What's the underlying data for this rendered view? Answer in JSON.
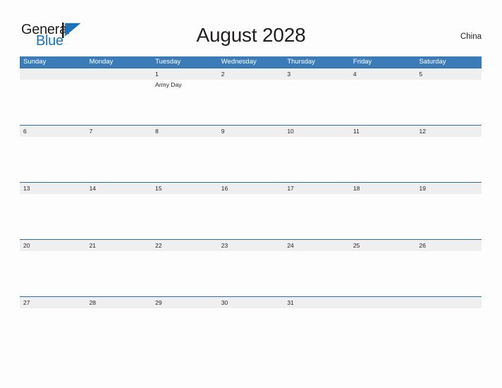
{
  "brand": {
    "name_part1": "General",
    "name_part2": "Blue",
    "mark_icon": "blue-triangle-logo-icon",
    "accent_color": "#1b74bb"
  },
  "header": {
    "title": "August 2028",
    "country": "China"
  },
  "colors": {
    "weekday_header_bg": "#3b7cb8",
    "date_band_bg": "#efefef",
    "row_divider": "#2e6da4",
    "page_bg": "#fdfdfd",
    "text": "#231f20"
  },
  "weekdays": [
    "Sunday",
    "Monday",
    "Tuesday",
    "Wednesday",
    "Thursday",
    "Friday",
    "Saturday"
  ],
  "weeks": [
    {
      "days": [
        {
          "num": "",
          "event": ""
        },
        {
          "num": "",
          "event": ""
        },
        {
          "num": "1",
          "event": "Army Day"
        },
        {
          "num": "2",
          "event": ""
        },
        {
          "num": "3",
          "event": ""
        },
        {
          "num": "4",
          "event": ""
        },
        {
          "num": "5",
          "event": ""
        }
      ]
    },
    {
      "days": [
        {
          "num": "6",
          "event": ""
        },
        {
          "num": "7",
          "event": ""
        },
        {
          "num": "8",
          "event": ""
        },
        {
          "num": "9",
          "event": ""
        },
        {
          "num": "10",
          "event": ""
        },
        {
          "num": "11",
          "event": ""
        },
        {
          "num": "12",
          "event": ""
        }
      ]
    },
    {
      "days": [
        {
          "num": "13",
          "event": ""
        },
        {
          "num": "14",
          "event": ""
        },
        {
          "num": "15",
          "event": ""
        },
        {
          "num": "16",
          "event": ""
        },
        {
          "num": "17",
          "event": ""
        },
        {
          "num": "18",
          "event": ""
        },
        {
          "num": "19",
          "event": ""
        }
      ]
    },
    {
      "days": [
        {
          "num": "20",
          "event": ""
        },
        {
          "num": "21",
          "event": ""
        },
        {
          "num": "22",
          "event": ""
        },
        {
          "num": "23",
          "event": ""
        },
        {
          "num": "24",
          "event": ""
        },
        {
          "num": "25",
          "event": ""
        },
        {
          "num": "26",
          "event": ""
        }
      ]
    },
    {
      "days": [
        {
          "num": "27",
          "event": ""
        },
        {
          "num": "28",
          "event": ""
        },
        {
          "num": "29",
          "event": ""
        },
        {
          "num": "30",
          "event": ""
        },
        {
          "num": "31",
          "event": ""
        },
        {
          "num": "",
          "event": ""
        },
        {
          "num": "",
          "event": ""
        }
      ]
    }
  ]
}
